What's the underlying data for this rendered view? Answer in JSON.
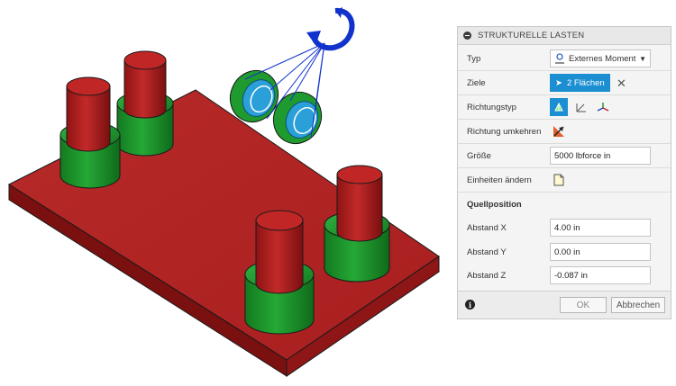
{
  "panel": {
    "title": "STRUKTURELLE LASTEN",
    "typ": {
      "label": "Typ",
      "value": "Externes Moment"
    },
    "ziele": {
      "label": "Ziele",
      "value": "2 Flächen"
    },
    "richtungstyp": {
      "label": "Richtungstyp"
    },
    "richtung_umkehren": {
      "label": "Richtung umkehren"
    },
    "groesse": {
      "label": "Größe",
      "value": "5000 lbforce in"
    },
    "einheiten": {
      "label": "Einheiten ändern"
    },
    "quellposition": {
      "heading": "Quellposition"
    },
    "abstand_x": {
      "label": "Abstand X",
      "value": "4.00 in"
    },
    "abstand_y": {
      "label": "Abstand Y",
      "value": "0.00 in"
    },
    "abstand_z": {
      "label": "Abstand Z",
      "value": "-0.087 in"
    },
    "ok_label": "OK",
    "cancel_label": "Abbrechen"
  },
  "colors": {
    "plate": "#b52424",
    "boss_green": "#1e9a2e",
    "pin_red": "#b71c1c",
    "selected_face": "#2a9fd8",
    "moment_glyph": "#1133cc",
    "accent_blue": "#1b8fd2"
  }
}
